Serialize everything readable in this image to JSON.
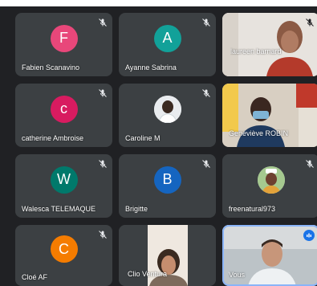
{
  "participants": [
    {
      "name": "Fabien Scanavino",
      "initial": "F",
      "color": "#e8477a",
      "muted": true
    },
    {
      "name": "Ayanne Sabrina",
      "initial": "A",
      "color": "#12a199",
      "muted": true
    },
    {
      "name": "laureen barnard",
      "muted": true,
      "video": true
    },
    {
      "name": "catherine Ambroise",
      "initial": "c",
      "color": "#d81b60",
      "muted": true
    },
    {
      "name": "Caroline M",
      "muted": true,
      "photo_avatar": true
    },
    {
      "name": "Geneviève ROBIN",
      "muted": false,
      "video": true
    },
    {
      "name": "Walesca TELEMAQUE",
      "initial": "W",
      "color": "#00796b",
      "muted": true
    },
    {
      "name": "Brigitte",
      "initial": "B",
      "color": "#1565c0",
      "muted": true
    },
    {
      "name": "freenatural973",
      "muted": true,
      "photo_avatar": true
    },
    {
      "name": "Cloé AF",
      "initial": "C",
      "color": "#f57c00",
      "muted": true
    },
    {
      "name": "Clio Ventura",
      "muted": false,
      "video": true
    },
    {
      "name": "Vous",
      "muted": false,
      "video": true,
      "speaking": true
    }
  ]
}
